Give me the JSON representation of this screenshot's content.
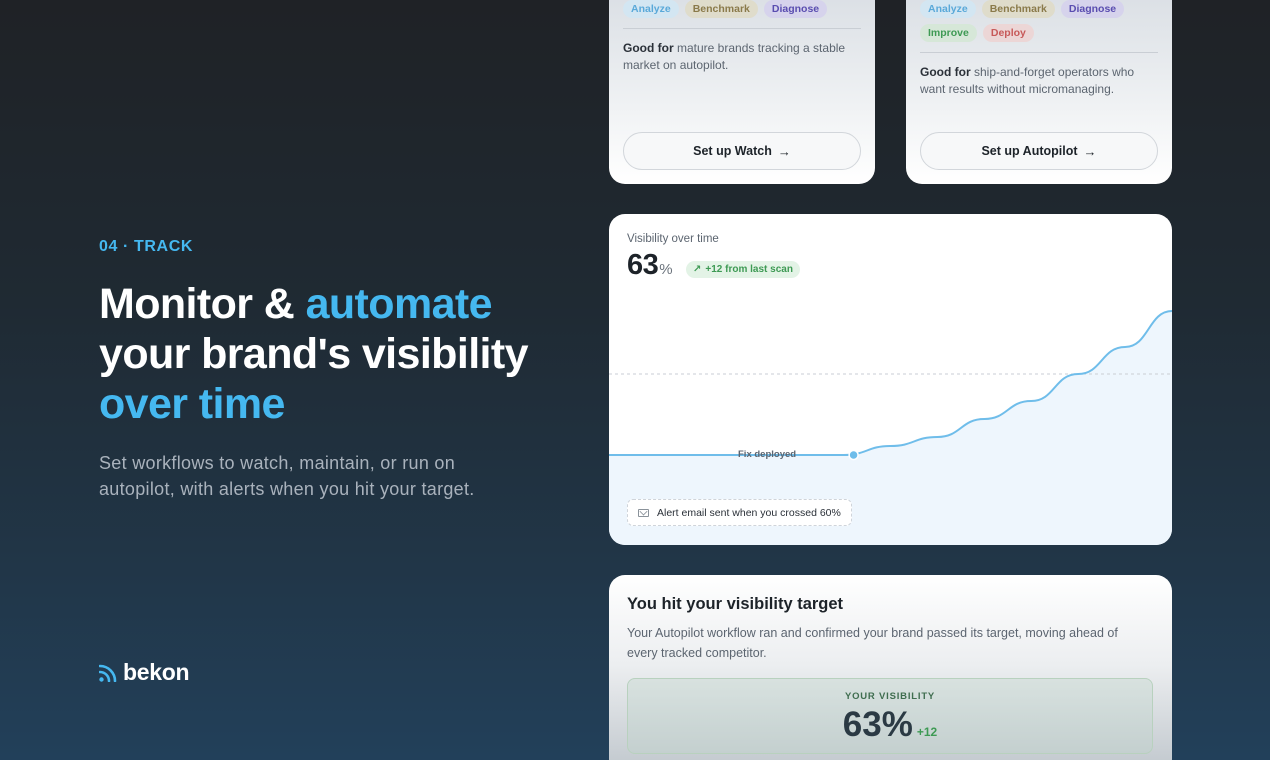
{
  "left": {
    "eyebrow": "04 · TRACK",
    "headline": {
      "part1": "Monitor & ",
      "accent1": "automate",
      "part2": "your brand's visibility",
      "accent2": "over time"
    },
    "subtext": "Set workflows to watch, maintain, or run on autopilot, with alerts when you hit your target.",
    "logo_text": "bekon",
    "logo_icon": "signal-waves-icon"
  },
  "workflow_cards": {
    "watch": {
      "chips": [
        "Analyze",
        "Benchmark",
        "Diagnose"
      ],
      "good_for_bold": "Good for",
      "good_for_text": " mature brands tracking a stable market on autopilot.",
      "button_label": "Set up Watch"
    },
    "autopilot": {
      "chips_row1": [
        "Analyze",
        "Benchmark",
        "Diagnose"
      ],
      "chips_row2": [
        "Improve",
        "Deploy"
      ],
      "good_for_bold": "Good for",
      "good_for_text": " ship-and-forget operators who want results without micromanaging.",
      "button_label": "Set up Autopilot"
    }
  },
  "chart_card": {
    "title": "Visibility over time",
    "value": "63",
    "value_unit": "%",
    "delta_badge": "+12 from last scan",
    "marker_label": "Fix deployed",
    "alert_text": "Alert email sent when you crossed 60%"
  },
  "chart_data": {
    "type": "area",
    "series": [
      {
        "values": [
          51,
          51,
          51,
          51,
          51,
          51,
          52,
          53,
          55,
          57,
          60,
          63,
          67
        ]
      }
    ],
    "target_line": 60,
    "marker": {
      "index": 5,
      "label": "Fix deployed"
    },
    "color": "#6fbdea"
  },
  "target_card": {
    "title": "You hit your visibility target",
    "text": "Your Autopilot workflow ran and confirmed your brand passed its target, moving ahead of every tracked competitor.",
    "box_label": "YOUR VISIBILITY",
    "box_value": "63%",
    "box_delta": "+12"
  },
  "colors": {
    "accent": "#45b8f0",
    "success": "#3e9a54"
  }
}
